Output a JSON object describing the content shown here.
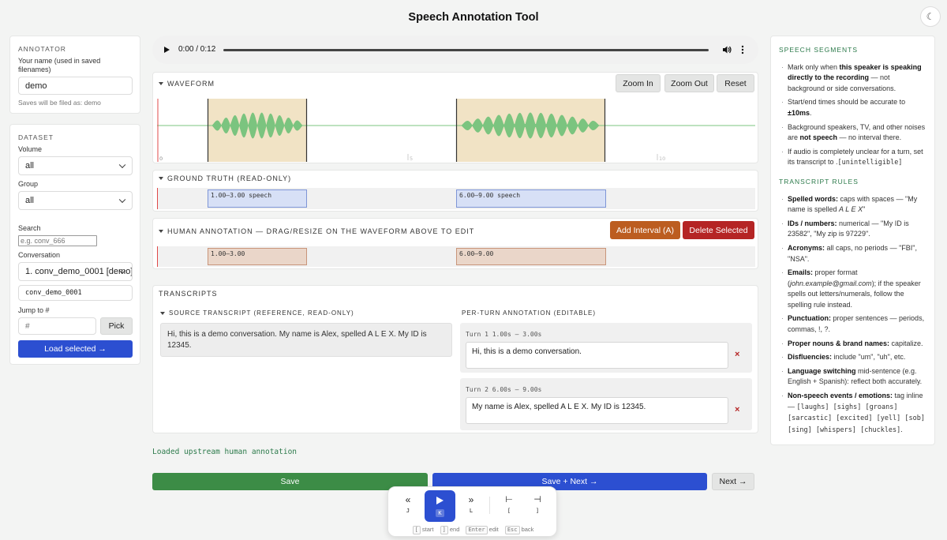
{
  "title": "Speech Annotation Tool",
  "theme_toggle": "☾",
  "annotator": {
    "heading": "ANNOTATOR",
    "name_label": "Your name (used in saved filenames)",
    "name_value": "demo",
    "saves_note": "Saves will be filed as: demo"
  },
  "dataset": {
    "heading": "DATASET",
    "volume_label": "Volume",
    "volume_value": "all",
    "group_label": "Group",
    "group_value": "all",
    "search_label": "Search",
    "search_placeholder": "e.g. conv_666",
    "conversation_label": "Conversation",
    "conversation_value": "1. conv_demo_0001 [demo]",
    "conversation_id": "conv_demo_0001",
    "jump_label": "Jump to #",
    "jump_placeholder": "#",
    "pick_label": "Pick",
    "load_label": "Load selected →"
  },
  "audio": {
    "time": "0:00 / 0:12"
  },
  "waveform": {
    "heading": "WAVEFORM",
    "zoom_in": "Zoom In",
    "zoom_out": "Zoom Out",
    "reset": "Reset",
    "ticks": [
      "0",
      "5",
      "10"
    ]
  },
  "ground_truth": {
    "heading": "GROUND TRUTH (READ-ONLY)",
    "segments": [
      "1.00–3.00 speech",
      "6.00–9.00 speech"
    ]
  },
  "human": {
    "heading": "HUMAN ANNOTATION — DRAG/RESIZE ON THE WAVEFORM ABOVE TO EDIT",
    "add_label": "Add Interval (A)",
    "delete_label": "Delete Selected",
    "segments": [
      "1.00–3.00",
      "6.00–9.00"
    ]
  },
  "transcripts": {
    "heading": "TRANSCRIPTS",
    "source_heading": "SOURCE TRANSCRIPT (REFERENCE, READ-ONLY)",
    "source_text": "Hi, this is a demo conversation. My name is Alex, spelled A L E X. My ID is 12345.",
    "per_turn_heading": "PER-TURN ANNOTATION (EDITABLE)",
    "turns": [
      {
        "label": "Turn 1 1.00s — 3.00s",
        "text": "Hi, this is a demo conversation."
      },
      {
        "label": "Turn 2 6.00s — 9.00s",
        "text": "My name is Alex, spelled A L E X. My ID is 12345."
      }
    ],
    "remove_icon": "×"
  },
  "status": "Loaded upstream human annotation",
  "actions": {
    "save": "Save",
    "save_next": "Save + Next →",
    "next": "Next →"
  },
  "player": {
    "back": {
      "glyph": "«",
      "key": "J"
    },
    "play": {
      "key": "K"
    },
    "fwd": {
      "glyph": "»",
      "key": "L"
    },
    "start": {
      "glyph": "⊢",
      "key": "["
    },
    "end": {
      "glyph": "⊣",
      "key": "]"
    },
    "hints": [
      {
        "key": "[",
        "label": "start"
      },
      {
        "key": "]",
        "label": "end"
      },
      {
        "key": "Enter",
        "label": "edit"
      },
      {
        "key": "Esc",
        "label": "back"
      }
    ]
  },
  "rules": {
    "speech_heading": "SPEECH SEGMENTS",
    "transcript_heading": "TRANSCRIPT RULES",
    "speech": [
      {
        "pre": "Mark only when ",
        "b": "this speaker is speaking directly to the recording",
        "post": " — not background or side conversations."
      },
      {
        "pre": "Start/end times should be accurate to ",
        "b": "±10ms",
        "post": "."
      },
      {
        "pre": "Background speakers, TV, and other noises are ",
        "b": "not speech",
        "post": " — no interval there."
      },
      {
        "pre": "If audio is completely unclear for a turn, set its transcript to ",
        "code": "[unintelligible]",
        "post": "."
      }
    ],
    "transcript": [
      {
        "b": "Spelled words:",
        "post": " caps with spaces — \"My name is spelled ",
        "i": "A L E X",
        "post2": "\""
      },
      {
        "b": "IDs / numbers:",
        "post": " numerical — \"My ID is 23582\", \"My zip is 97229\"."
      },
      {
        "b": "Acronyms:",
        "post": " all caps, no periods — \"FBI\", \"NSA\"."
      },
      {
        "b": "Emails:",
        "post": " proper format (",
        "i": "john.example@gmail.com",
        "post2": "); if the speaker spells out letters/numerals, follow the spelling rule instead."
      },
      {
        "b": "Punctuation:",
        "post": " proper sentences — periods, commas, !, ?."
      },
      {
        "b": "Proper nouns & brand names:",
        "post": " capitalize."
      },
      {
        "b": "Disfluencies:",
        "post": " include \"um\", \"uh\", etc."
      },
      {
        "b": "Language switching",
        "post": " mid-sentence (e.g. English + Spanish): reflect both accurately."
      },
      {
        "b": "Non-speech events / emotions:",
        "post": " tag inline — ",
        "code": "[laughs] [sighs] [groans] [sarcastic] [excited] [yell] [sob] [sing] [whispers] [chuckles]",
        "post2": "."
      }
    ]
  },
  "colors": {
    "accent_blue": "#2c4fd1",
    "save_green": "#3c8c46",
    "add_orange": "#bc5d20",
    "delete_red": "#b52525",
    "wave_green": "#7bc47f",
    "segment_fill": "#f1e3c5"
  }
}
